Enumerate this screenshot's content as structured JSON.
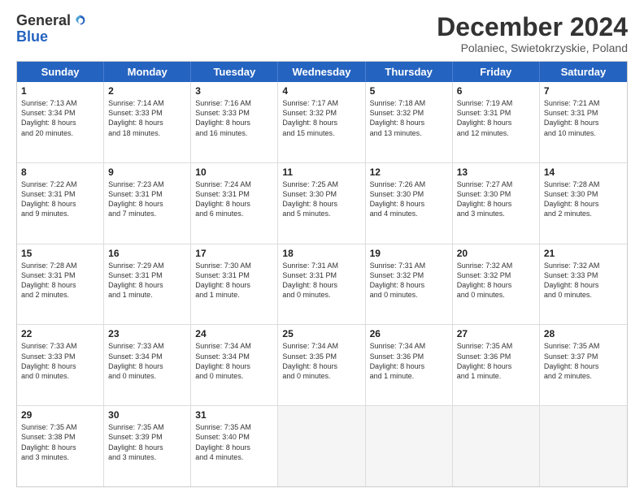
{
  "logo": {
    "general": "General",
    "blue": "Blue"
  },
  "title": "December 2024",
  "location": "Polaniec, Swietokrzyskie, Poland",
  "header_days": [
    "Sunday",
    "Monday",
    "Tuesday",
    "Wednesday",
    "Thursday",
    "Friday",
    "Saturday"
  ],
  "weeks": [
    [
      {
        "day": "1",
        "lines": [
          "Sunrise: 7:13 AM",
          "Sunset: 3:34 PM",
          "Daylight: 8 hours",
          "and 20 minutes."
        ]
      },
      {
        "day": "2",
        "lines": [
          "Sunrise: 7:14 AM",
          "Sunset: 3:33 PM",
          "Daylight: 8 hours",
          "and 18 minutes."
        ]
      },
      {
        "day": "3",
        "lines": [
          "Sunrise: 7:16 AM",
          "Sunset: 3:33 PM",
          "Daylight: 8 hours",
          "and 16 minutes."
        ]
      },
      {
        "day": "4",
        "lines": [
          "Sunrise: 7:17 AM",
          "Sunset: 3:32 PM",
          "Daylight: 8 hours",
          "and 15 minutes."
        ]
      },
      {
        "day": "5",
        "lines": [
          "Sunrise: 7:18 AM",
          "Sunset: 3:32 PM",
          "Daylight: 8 hours",
          "and 13 minutes."
        ]
      },
      {
        "day": "6",
        "lines": [
          "Sunrise: 7:19 AM",
          "Sunset: 3:31 PM",
          "Daylight: 8 hours",
          "and 12 minutes."
        ]
      },
      {
        "day": "7",
        "lines": [
          "Sunrise: 7:21 AM",
          "Sunset: 3:31 PM",
          "Daylight: 8 hours",
          "and 10 minutes."
        ]
      }
    ],
    [
      {
        "day": "8",
        "lines": [
          "Sunrise: 7:22 AM",
          "Sunset: 3:31 PM",
          "Daylight: 8 hours",
          "and 9 minutes."
        ]
      },
      {
        "day": "9",
        "lines": [
          "Sunrise: 7:23 AM",
          "Sunset: 3:31 PM",
          "Daylight: 8 hours",
          "and 7 minutes."
        ]
      },
      {
        "day": "10",
        "lines": [
          "Sunrise: 7:24 AM",
          "Sunset: 3:31 PM",
          "Daylight: 8 hours",
          "and 6 minutes."
        ]
      },
      {
        "day": "11",
        "lines": [
          "Sunrise: 7:25 AM",
          "Sunset: 3:30 PM",
          "Daylight: 8 hours",
          "and 5 minutes."
        ]
      },
      {
        "day": "12",
        "lines": [
          "Sunrise: 7:26 AM",
          "Sunset: 3:30 PM",
          "Daylight: 8 hours",
          "and 4 minutes."
        ]
      },
      {
        "day": "13",
        "lines": [
          "Sunrise: 7:27 AM",
          "Sunset: 3:30 PM",
          "Daylight: 8 hours",
          "and 3 minutes."
        ]
      },
      {
        "day": "14",
        "lines": [
          "Sunrise: 7:28 AM",
          "Sunset: 3:30 PM",
          "Daylight: 8 hours",
          "and 2 minutes."
        ]
      }
    ],
    [
      {
        "day": "15",
        "lines": [
          "Sunrise: 7:28 AM",
          "Sunset: 3:31 PM",
          "Daylight: 8 hours",
          "and 2 minutes."
        ]
      },
      {
        "day": "16",
        "lines": [
          "Sunrise: 7:29 AM",
          "Sunset: 3:31 PM",
          "Daylight: 8 hours",
          "and 1 minute."
        ]
      },
      {
        "day": "17",
        "lines": [
          "Sunrise: 7:30 AM",
          "Sunset: 3:31 PM",
          "Daylight: 8 hours",
          "and 1 minute."
        ]
      },
      {
        "day": "18",
        "lines": [
          "Sunrise: 7:31 AM",
          "Sunset: 3:31 PM",
          "Daylight: 8 hours",
          "and 0 minutes."
        ]
      },
      {
        "day": "19",
        "lines": [
          "Sunrise: 7:31 AM",
          "Sunset: 3:32 PM",
          "Daylight: 8 hours",
          "and 0 minutes."
        ]
      },
      {
        "day": "20",
        "lines": [
          "Sunrise: 7:32 AM",
          "Sunset: 3:32 PM",
          "Daylight: 8 hours",
          "and 0 minutes."
        ]
      },
      {
        "day": "21",
        "lines": [
          "Sunrise: 7:32 AM",
          "Sunset: 3:33 PM",
          "Daylight: 8 hours",
          "and 0 minutes."
        ]
      }
    ],
    [
      {
        "day": "22",
        "lines": [
          "Sunrise: 7:33 AM",
          "Sunset: 3:33 PM",
          "Daylight: 8 hours",
          "and 0 minutes."
        ]
      },
      {
        "day": "23",
        "lines": [
          "Sunrise: 7:33 AM",
          "Sunset: 3:34 PM",
          "Daylight: 8 hours",
          "and 0 minutes."
        ]
      },
      {
        "day": "24",
        "lines": [
          "Sunrise: 7:34 AM",
          "Sunset: 3:34 PM",
          "Daylight: 8 hours",
          "and 0 minutes."
        ]
      },
      {
        "day": "25",
        "lines": [
          "Sunrise: 7:34 AM",
          "Sunset: 3:35 PM",
          "Daylight: 8 hours",
          "and 0 minutes."
        ]
      },
      {
        "day": "26",
        "lines": [
          "Sunrise: 7:34 AM",
          "Sunset: 3:36 PM",
          "Daylight: 8 hours",
          "and 1 minute."
        ]
      },
      {
        "day": "27",
        "lines": [
          "Sunrise: 7:35 AM",
          "Sunset: 3:36 PM",
          "Daylight: 8 hours",
          "and 1 minute."
        ]
      },
      {
        "day": "28",
        "lines": [
          "Sunrise: 7:35 AM",
          "Sunset: 3:37 PM",
          "Daylight: 8 hours",
          "and 2 minutes."
        ]
      }
    ],
    [
      {
        "day": "29",
        "lines": [
          "Sunrise: 7:35 AM",
          "Sunset: 3:38 PM",
          "Daylight: 8 hours",
          "and 3 minutes."
        ]
      },
      {
        "day": "30",
        "lines": [
          "Sunrise: 7:35 AM",
          "Sunset: 3:39 PM",
          "Daylight: 8 hours",
          "and 3 minutes."
        ]
      },
      {
        "day": "31",
        "lines": [
          "Sunrise: 7:35 AM",
          "Sunset: 3:40 PM",
          "Daylight: 8 hours",
          "and 4 minutes."
        ]
      },
      {
        "day": "",
        "lines": []
      },
      {
        "day": "",
        "lines": []
      },
      {
        "day": "",
        "lines": []
      },
      {
        "day": "",
        "lines": []
      }
    ]
  ]
}
